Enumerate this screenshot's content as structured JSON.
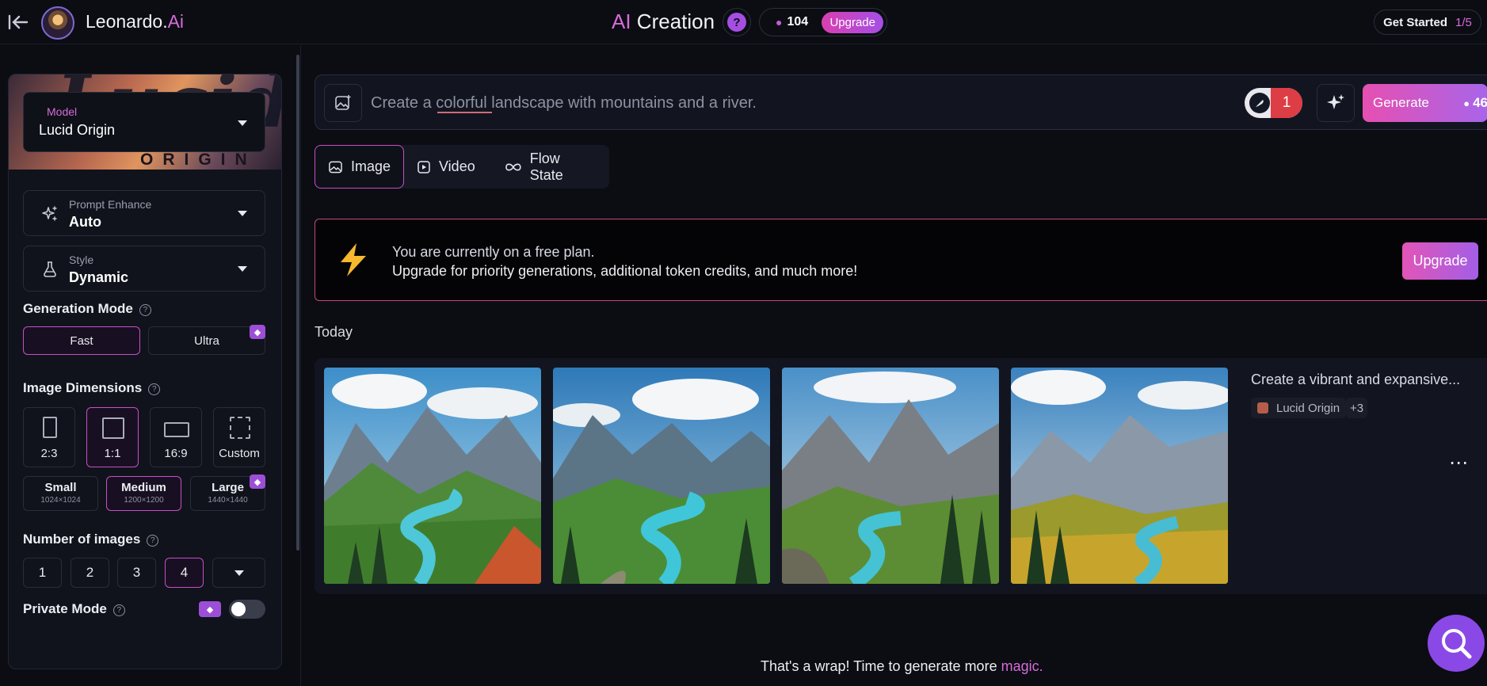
{
  "topbar": {
    "brand_main": "Leonardo.",
    "brand_ai": "Ai",
    "title_ai": "AI",
    "title_rest": " Creation",
    "help": "?",
    "tokens": "104",
    "upgrade": "Upgrade",
    "get_started": "Get Started",
    "get_started_step": "1/5"
  },
  "sidebar": {
    "model": {
      "banner_script": "Lucid",
      "banner_word": "ORIGIN",
      "label": "Model",
      "value": "Lucid Origin"
    },
    "prompt_enhance": {
      "label": "Prompt Enhance",
      "value": "Auto"
    },
    "style": {
      "label": "Style",
      "value": "Dynamic"
    },
    "generation_mode": {
      "title": "Generation Mode",
      "options": [
        "Fast",
        "Ultra"
      ],
      "selected": "Fast"
    },
    "image_dimensions": {
      "title": "Image Dimensions",
      "ratios": [
        "2:3",
        "1:1",
        "16:9",
        "Custom"
      ],
      "selected_ratio": "1:1",
      "sizes": [
        {
          "name": "Small",
          "res": "1024×1024"
        },
        {
          "name": "Medium",
          "res": "1200×1200"
        },
        {
          "name": "Large",
          "res": "1440×1440"
        }
      ],
      "selected_size": "Medium"
    },
    "number_of_images": {
      "title": "Number of images",
      "options": [
        "1",
        "2",
        "3",
        "4"
      ],
      "selected": "4"
    },
    "private_mode": {
      "title": "Private Mode",
      "enabled": false
    }
  },
  "prompt": {
    "placeholder": "Create a colorful landscape with mountains and a river.",
    "brush_count": "1",
    "generate_label": "Generate",
    "generate_cost": "46"
  },
  "tabs": [
    {
      "label": "Image",
      "icon": "image-icon"
    },
    {
      "label": "Video",
      "icon": "video-icon"
    },
    {
      "label": "Flow State",
      "icon": "infinity-icon"
    }
  ],
  "banner": {
    "line1": "You are currently on a free plan.",
    "line2": "Upgrade for priority generations, additional token credits, and much more!",
    "upgrade": "Upgrade"
  },
  "today_label": "Today",
  "generation": {
    "prompt_preview": "Create a vibrant and expansive...",
    "model": "Lucid Origin",
    "extra": "+3",
    "more": "⋯"
  },
  "footer": {
    "message": "That's a wrap! Time to generate more ",
    "magic": "magic."
  },
  "colors": {
    "accent_pink": "#d66bd9",
    "accent_purple": "#a54fe6",
    "alert_red": "#dd3d44",
    "fab": "#8a49e6"
  }
}
